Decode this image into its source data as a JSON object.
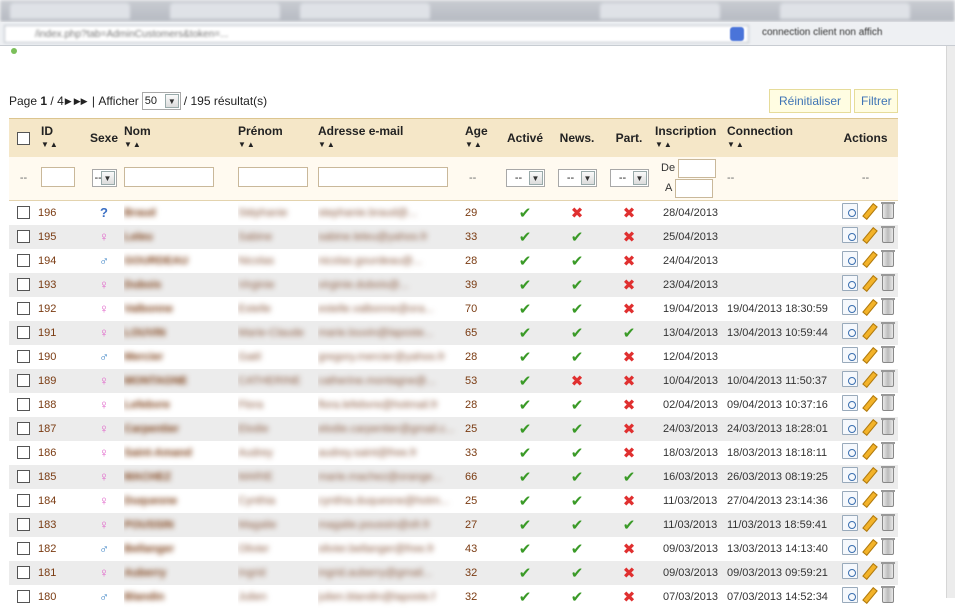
{
  "browser": {
    "url": "/index.php?tab=AdminCustomers&token=...",
    "extension_text": "connection client non affich"
  },
  "pager": {
    "page_label": "Page",
    "current_page": "1",
    "total_pages": "4",
    "show_label": "Afficher",
    "per_page": "50",
    "results": "/ 195 résultat(s)"
  },
  "buttons": {
    "reset": "Réinitialiser",
    "filter": "Filtrer"
  },
  "columns": {
    "id": "ID",
    "sex": "Sexe",
    "lastname": "Nom",
    "firstname": "Prénom",
    "email": "Adresse e-mail",
    "age": "Age",
    "active": "Activé",
    "newsletter": "News.",
    "partner": "Part.",
    "signup": "Inscription",
    "connection": "Connection",
    "actions": "Actions"
  },
  "filters": {
    "dash": "--",
    "select_value": "--",
    "date_from": "De",
    "date_to": "A"
  },
  "rows": [
    {
      "id": "196",
      "sex": "unknown",
      "nom": "Braud",
      "prenom": "Stéphanie",
      "email": "stephanie.braud@...",
      "age": "29",
      "active": true,
      "news": false,
      "part": false,
      "inscription": "28/04/2013",
      "connection": ""
    },
    {
      "id": "195",
      "sex": "female",
      "nom": "Leleu",
      "prenom": "Sabine",
      "email": "sabine.leleu@yahoo.fr",
      "age": "33",
      "active": true,
      "news": true,
      "part": false,
      "inscription": "25/04/2013",
      "connection": ""
    },
    {
      "id": "194",
      "sex": "male",
      "nom": "GOURDEAU",
      "prenom": "Nicolas",
      "email": "nicolas.gourdeau@...",
      "age": "28",
      "active": true,
      "news": true,
      "part": false,
      "inscription": "24/04/2013",
      "connection": ""
    },
    {
      "id": "193",
      "sex": "female",
      "nom": "Dubois",
      "prenom": "Virginie",
      "email": "virginie.dubois@...",
      "age": "39",
      "active": true,
      "news": true,
      "part": false,
      "inscription": "23/04/2013",
      "connection": ""
    },
    {
      "id": "192",
      "sex": "female",
      "nom": "Valbonne",
      "prenom": "Estelle",
      "email": "estelle.valbonne@ora...",
      "age": "70",
      "active": true,
      "news": true,
      "part": false,
      "inscription": "19/04/2013",
      "connection": "19/04/2013 18:30:59"
    },
    {
      "id": "191",
      "sex": "female",
      "nom": "LOUVIN",
      "prenom": "Marie-Claude",
      "email": "marie.louvin@laposte...",
      "age": "65",
      "active": true,
      "news": true,
      "part": true,
      "inscription": "13/04/2013",
      "connection": "13/04/2013 10:59:44"
    },
    {
      "id": "190",
      "sex": "male",
      "nom": "Mercier",
      "prenom": "Gaël",
      "email": "gregory.mercier@yahoo.fr",
      "age": "28",
      "active": true,
      "news": true,
      "part": false,
      "inscription": "12/04/2013",
      "connection": ""
    },
    {
      "id": "189",
      "sex": "female",
      "nom": "MONTAGNE",
      "prenom": "CATHERINE",
      "email": "catherine.montagne@...",
      "age": "53",
      "active": true,
      "news": false,
      "part": false,
      "inscription": "10/04/2013",
      "connection": "10/04/2013 11:50:37"
    },
    {
      "id": "188",
      "sex": "female",
      "nom": "Lefebvre",
      "prenom": "Flora",
      "email": "flora.lefebvre@hotmail.fr",
      "age": "28",
      "active": true,
      "news": true,
      "part": false,
      "inscription": "02/04/2013",
      "connection": "09/04/2013 10:37:16"
    },
    {
      "id": "187",
      "sex": "female",
      "nom": "Carpentier",
      "prenom": "Elodie",
      "email": "elodie.carpentier@gmail.c...",
      "age": "25",
      "active": true,
      "news": true,
      "part": false,
      "inscription": "24/03/2013",
      "connection": "24/03/2013 18:28:01"
    },
    {
      "id": "186",
      "sex": "female",
      "nom": "Saint-Amand",
      "prenom": "Audrey",
      "email": "audrey.saint@free.fr",
      "age": "33",
      "active": true,
      "news": true,
      "part": false,
      "inscription": "18/03/2013",
      "connection": "18/03/2013 18:18:11"
    },
    {
      "id": "185",
      "sex": "female",
      "nom": "MACHEZ",
      "prenom": "MARIE",
      "email": "marie.machez@orange...",
      "age": "66",
      "active": true,
      "news": true,
      "part": true,
      "inscription": "16/03/2013",
      "connection": "26/03/2013 08:19:25"
    },
    {
      "id": "184",
      "sex": "female",
      "nom": "Duquesne",
      "prenom": "Cynthia",
      "email": "cynthia.duquesne@hotm...",
      "age": "25",
      "active": true,
      "news": true,
      "part": false,
      "inscription": "11/03/2013",
      "connection": "27/04/2013 23:14:36"
    },
    {
      "id": "183",
      "sex": "female",
      "nom": "POUSSIN",
      "prenom": "Magalie",
      "email": "magalie.poussin@sfr.fr",
      "age": "27",
      "active": true,
      "news": true,
      "part": true,
      "inscription": "11/03/2013",
      "connection": "11/03/2013 18:59:41"
    },
    {
      "id": "182",
      "sex": "male",
      "nom": "Bellanger",
      "prenom": "Olivier",
      "email": "olivier.bellanger@free.fr",
      "age": "43",
      "active": true,
      "news": true,
      "part": false,
      "inscription": "09/03/2013",
      "connection": "13/03/2013 14:13:40"
    },
    {
      "id": "181",
      "sex": "female",
      "nom": "Auberry",
      "prenom": "Ingrid",
      "email": "ingrid.auberry@gmail...",
      "age": "32",
      "active": true,
      "news": true,
      "part": false,
      "inscription": "09/03/2013",
      "connection": "09/03/2013 09:59:21"
    },
    {
      "id": "180",
      "sex": "male",
      "nom": "Blandin",
      "prenom": "Julien",
      "email": "julien.blandin@laposte.f",
      "age": "32",
      "active": true,
      "news": true,
      "part": false,
      "inscription": "07/03/2013",
      "connection": "07/03/2013 14:52:34"
    }
  ]
}
